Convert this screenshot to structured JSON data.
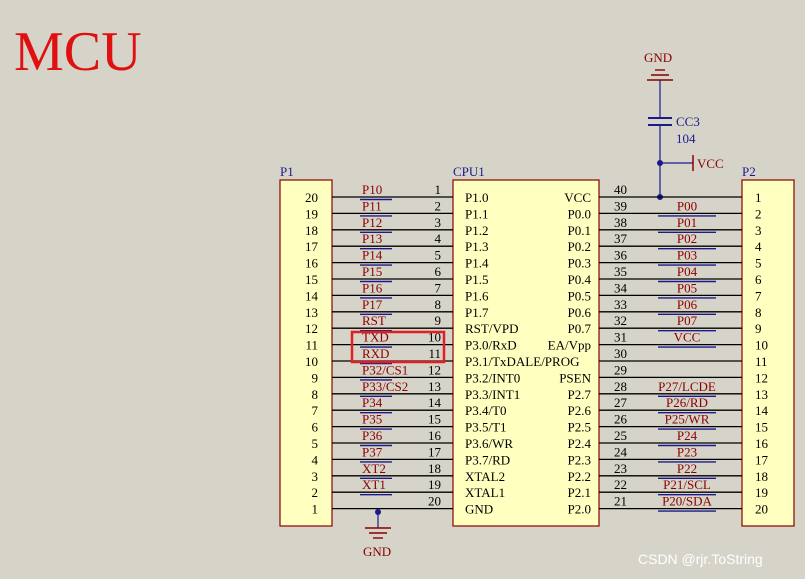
{
  "title": "MCU",
  "watermark": "CSDN @rjr.ToString",
  "p1": {
    "designator": "P1",
    "pin_numbers": [
      "20",
      "19",
      "18",
      "17",
      "16",
      "15",
      "14",
      "13",
      "12",
      "11",
      "10",
      "9",
      "8",
      "7",
      "6",
      "5",
      "4",
      "3",
      "2",
      "1"
    ]
  },
  "p2": {
    "designator": "P2",
    "pin_numbers": [
      "1",
      "2",
      "3",
      "4",
      "5",
      "6",
      "7",
      "8",
      "9",
      "10",
      "11",
      "12",
      "13",
      "14",
      "15",
      "16",
      "17",
      "18",
      "19",
      "20"
    ]
  },
  "cpu": {
    "designator": "CPU1",
    "left_pin_numbers": [
      "1",
      "2",
      "3",
      "4",
      "5",
      "6",
      "7",
      "8",
      "9",
      "10",
      "11",
      "12",
      "13",
      "14",
      "15",
      "16",
      "17",
      "18",
      "19",
      "20"
    ],
    "left_pin_names": [
      "P1.0",
      "P1.1",
      "P1.2",
      "P1.3",
      "P1.4",
      "P1.5",
      "P1.6",
      "P1.7",
      "RST/VPD",
      "P3.0/RxD",
      "P3.1/TxDALE/PROG",
      "P3.2/INT0",
      "P3.3/INT1",
      "P3.4/T0",
      "P3.5/T1",
      "P3.6/WR",
      "P3.7/RD",
      "XTAL2",
      "XTAL1",
      "GND"
    ],
    "right_pin_numbers": [
      "40",
      "39",
      "38",
      "37",
      "36",
      "35",
      "34",
      "33",
      "32",
      "31",
      "30",
      "29",
      "28",
      "27",
      "26",
      "25",
      "24",
      "23",
      "22",
      "21"
    ],
    "right_pin_names": [
      "VCC",
      "P0.0",
      "P0.1",
      "P0.2",
      "P0.3",
      "P0.4",
      "P0.5",
      "P0.6",
      "P0.7",
      "EA/Vpp",
      "",
      "PSEN",
      "P2.7",
      "P2.6",
      "P2.5",
      "P2.4",
      "P2.3",
      "P2.2",
      "P2.1",
      "P2.0"
    ]
  },
  "left_nets": [
    "P10",
    "P11",
    "P12",
    "P13",
    "P14",
    "P15",
    "P16",
    "P17",
    "RST",
    "TXD",
    "RXD",
    "P32/CS1",
    "P33/CS2",
    "P34",
    "P35",
    "P36",
    "P37",
    "XT2",
    "XT1",
    ""
  ],
  "right_nets": [
    "",
    "P00",
    "P01",
    "P02",
    "P03",
    "P04",
    "P05",
    "P06",
    "P07",
    "VCC",
    "",
    "",
    "P27/LCDE",
    "P26/RD",
    "P25/WR",
    "P24",
    "P23",
    "P22",
    "P21/SCL",
    "P20/SDA"
  ],
  "highlighted_nets": [
    "TXD",
    "RXD"
  ],
  "capacitor": {
    "designator": "CC3",
    "value": "104"
  },
  "power": {
    "gnd_top": "GND",
    "gnd_bottom": "GND",
    "vcc": "VCC"
  },
  "colors": {
    "background": "#d6d3c8",
    "component_fill": "#ffffc0",
    "component_stroke": "#8b0000",
    "net_label": "#8b0000",
    "designator": "#1a1a8c",
    "highlight_box": "#e02020",
    "title": "#e01010"
  }
}
